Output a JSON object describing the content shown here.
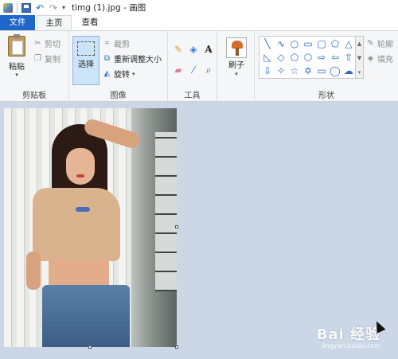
{
  "window": {
    "title": "timg (1).jpg - 画图"
  },
  "tabs": [
    {
      "label": "文件"
    },
    {
      "label": "主页"
    },
    {
      "label": "查看"
    }
  ],
  "clipboard": {
    "paste": "粘贴",
    "cut": "剪切",
    "copy": "复制",
    "group": "剪贴板"
  },
  "image": {
    "select": "选择",
    "crop": "裁剪",
    "resize": "重新调整大小",
    "rotate": "旋转",
    "group": "图像"
  },
  "tools": {
    "group": "工具"
  },
  "brush": {
    "label": "刷子"
  },
  "shapes": {
    "group": "形状",
    "outline": "轮廓",
    "fill": "填充"
  },
  "watermark": {
    "brand": "Bai 经验",
    "url": "jingyan.baidu.com"
  },
  "colors": {
    "file_tab": "#1e66c7",
    "ribbon": "#f5f6f7",
    "canvas_bg": "#cbd6e6",
    "accent": "#2a6cc4"
  },
  "icons": [
    "pencil-icon",
    "fill-icon",
    "text-icon",
    "eraser-icon",
    "color-picker-icon",
    "magnifier-icon"
  ]
}
